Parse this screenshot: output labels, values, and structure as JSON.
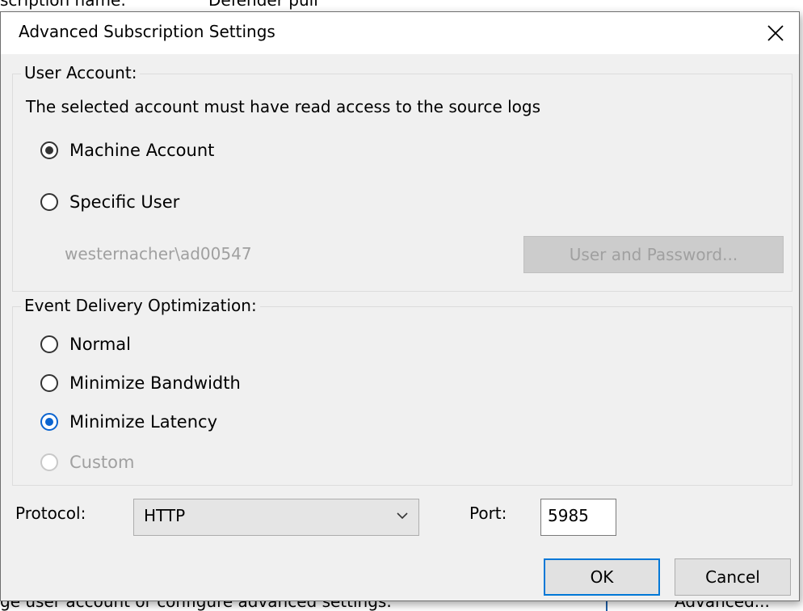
{
  "background": {
    "frag_top": "scription name:",
    "frag_top_value": "Defender pull",
    "frag_bottom": "ge user account or configure advanced settings.",
    "frag_bottom_right": "Advanced..."
  },
  "dialog": {
    "title": "Advanced Subscription Settings",
    "close_glyph": "✕"
  },
  "user_account": {
    "legend": "User Account:",
    "description": "The selected account must have read access to the source logs",
    "options": [
      {
        "label": "Machine Account",
        "checked": true,
        "disabled": false
      },
      {
        "label": "Specific User",
        "checked": false,
        "disabled": false
      }
    ],
    "username": "westernacher\\ad00547",
    "user_password_button": "User and Password..."
  },
  "event_delivery": {
    "legend": "Event Delivery Optimization:",
    "options": [
      {
        "label": "Normal",
        "checked": false,
        "disabled": false
      },
      {
        "label": "Minimize Bandwidth",
        "checked": false,
        "disabled": false
      },
      {
        "label": "Minimize Latency",
        "checked": true,
        "disabled": false
      },
      {
        "label": "Custom",
        "checked": false,
        "disabled": true
      }
    ]
  },
  "protocol": {
    "label": "Protocol:",
    "value": "HTTP"
  },
  "port": {
    "label": "Port:",
    "value": "5985"
  },
  "buttons": {
    "ok": "OK",
    "cancel": "Cancel"
  },
  "icons": {
    "close": "close-icon",
    "dropdown": "chevron-down-icon"
  },
  "colors": {
    "accent": "#0078d7",
    "radio_selected_blue": "#0a64d0",
    "dialog_bg": "#f0f0f0",
    "disabled_text": "#a0a0a0"
  }
}
